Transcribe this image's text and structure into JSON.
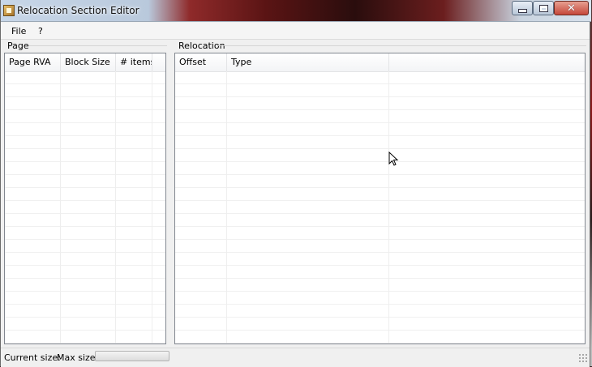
{
  "window": {
    "title": "Relocation Section Editor",
    "controls": {
      "minimize": "minimize",
      "maximize": "maximize",
      "close": "close"
    }
  },
  "menu": {
    "items": [
      {
        "label": "File"
      },
      {
        "label": "?"
      }
    ]
  },
  "page_group": {
    "label": "Page",
    "columns": [
      "Page RVA",
      "Block Size",
      "# items"
    ],
    "rows": []
  },
  "relocation_group": {
    "label": "Relocation",
    "columns": [
      "Offset",
      "Type",
      ""
    ],
    "rows": []
  },
  "status": {
    "current_size_label": "Current size:",
    "max_size_label": "Max size:",
    "progress": 0
  },
  "icons": {
    "app": "app-icon",
    "cursor": "mouse-pointer-icon"
  }
}
